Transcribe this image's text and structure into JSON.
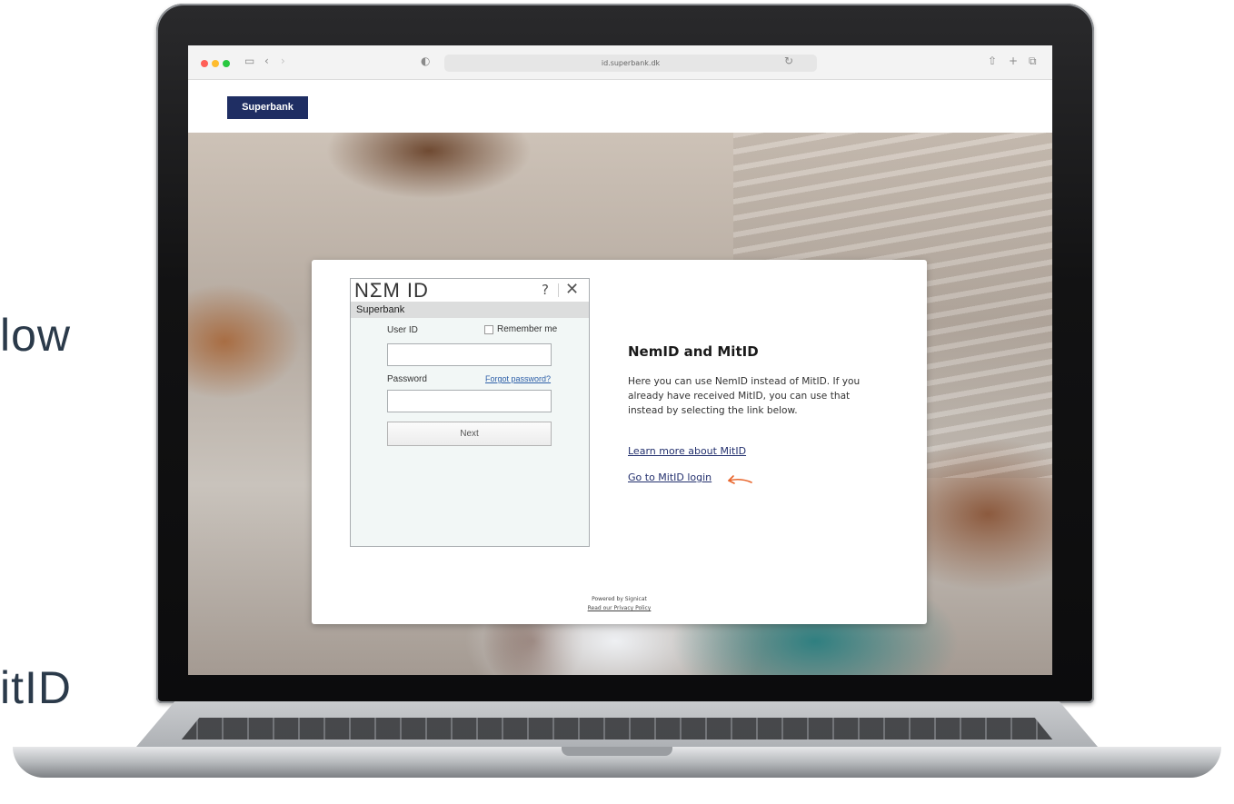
{
  "side_text": {
    "top": "low",
    "bottom": "itID"
  },
  "browser": {
    "url": "id.superbank.dk",
    "icons": [
      "sidebar-icon",
      "back-icon",
      "forward-icon",
      "shield-icon",
      "reload-icon",
      "share-icon",
      "new-tab-icon",
      "tabs-icon"
    ]
  },
  "header": {
    "brand": "Superbank"
  },
  "nemid": {
    "logo": "NΣM ID",
    "help": "?",
    "close": "✕",
    "bank_name": "Superbank",
    "user_id_label": "User ID",
    "remember_label": "Remember me",
    "user_id_value": "",
    "password_label": "Password",
    "forgot_link": "Forgot password?",
    "password_value": "",
    "next_label": "Next"
  },
  "info": {
    "title": "NemID and MitID",
    "body": "Here you can use NemID instead of MitID. If you already have received MitID, you can use that instead by selecting the link below.",
    "learn_more": "Learn more about MitID",
    "go_to": "Go to MitID login"
  },
  "footer": {
    "powered": "Powered by Signicat",
    "privacy": "Read our Privacy Policy"
  },
  "colors": {
    "brand": "#1f2e63",
    "link": "#23306e",
    "arrow": "#e8652b"
  }
}
